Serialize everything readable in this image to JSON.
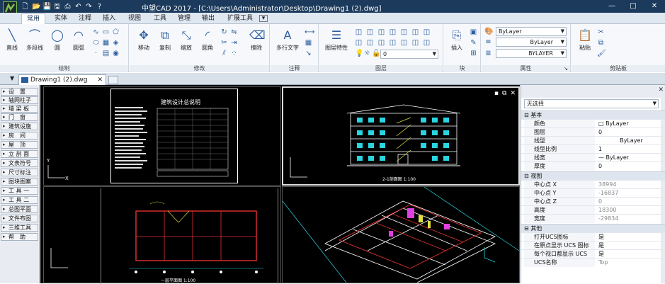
{
  "titlebar": {
    "app_title": "中望CAD 2017  - [C:\\Users\\Administrator\\Desktop\\Drawing1 (2).dwg]",
    "controls": [
      "—",
      "□",
      "✕"
    ]
  },
  "ribbon_tabs": [
    "常用",
    "实体",
    "注释",
    "插入",
    "视图",
    "工具",
    "管理",
    "输出",
    "扩展工具"
  ],
  "ribbon_dropdown_glyph": "▾",
  "groups": {
    "draw": {
      "label": "绘制",
      "tools": [
        "直线",
        "多段线",
        "圆",
        "圆弧"
      ]
    },
    "modify": {
      "label": "修改",
      "tools": [
        "移动",
        "复制",
        "缩放",
        "圆角",
        "擦除"
      ]
    },
    "annotation": {
      "label": "注释",
      "tools": [
        "多行文字"
      ]
    },
    "layer": {
      "label": "图层",
      "tools": [
        "图层特性"
      ],
      "layer_value": "0"
    },
    "block": {
      "label": "块",
      "tools": [
        "插入"
      ]
    },
    "properties": {
      "label": "属性",
      "color": "ByLayer",
      "linetype": "ByLayer",
      "lineweight": "BYLAYER"
    },
    "clipboard": {
      "label": "剪贴板",
      "tools": [
        "粘贴"
      ]
    }
  },
  "doc_tab": {
    "title": "Drawing1 (2).dwg",
    "close": "✕"
  },
  "sidebar_items": [
    "设　置",
    "轴网柱子",
    "墙 梁 板",
    "门　窗",
    "建筑设施",
    "房　间",
    "屋　顶",
    "立 剖 面",
    "文表符号",
    "尺寸标注",
    "图块图案",
    "工 具 一",
    "工 具 二",
    "总图平面",
    "文件布图",
    "三维工具",
    "帮　助"
  ],
  "drawings": {
    "sheet_title": "建筑设计总说明",
    "elevation_label": "2-1剖面图 1:100",
    "plan_label": "一层平面图 1:100",
    "axis_x": "X",
    "axis_y": "Y"
  },
  "properties_panel": {
    "selection": "无选择",
    "sections": [
      {
        "name": "基本",
        "rows": [
          {
            "key": "颜色",
            "value": "□ ByLayer",
            "grey": false
          },
          {
            "key": "图层",
            "value": "0",
            "grey": false
          },
          {
            "key": "线型",
            "value": "ByLayer",
            "grey": false
          },
          {
            "key": "线型比例",
            "value": "1",
            "grey": false
          },
          {
            "key": "线宽",
            "value": "— ByLayer",
            "grey": false
          },
          {
            "key": "厚度",
            "value": "0",
            "grey": false
          }
        ]
      },
      {
        "name": "视图",
        "rows": [
          {
            "key": "中心点 X",
            "value": "38994",
            "grey": true
          },
          {
            "key": "中心点 Y",
            "value": "-16837",
            "grey": true
          },
          {
            "key": "中心点 Z",
            "value": "0",
            "grey": true
          },
          {
            "key": "高度",
            "value": "18300",
            "grey": true
          },
          {
            "key": "宽度",
            "value": "-29834",
            "grey": true
          }
        ]
      },
      {
        "name": "其他",
        "rows": [
          {
            "key": "打开UCS图标",
            "value": "是",
            "grey": false
          },
          {
            "key": "在原点显示 UCS 图标",
            "value": "是",
            "grey": false
          },
          {
            "key": "每个视口都显示 UCS",
            "value": "是",
            "grey": false
          },
          {
            "key": "UCS名称",
            "value": "Top",
            "grey": true
          }
        ]
      }
    ]
  },
  "colors": {
    "title_bar": "#1b3a5c",
    "accent": "#2a5d9f",
    "cad_background": "#000000",
    "wire_white": "#ffffff",
    "wire_red": "#e03030",
    "wire_cyan": "#2ad4e0",
    "wire_magenta": "#e040e0"
  }
}
